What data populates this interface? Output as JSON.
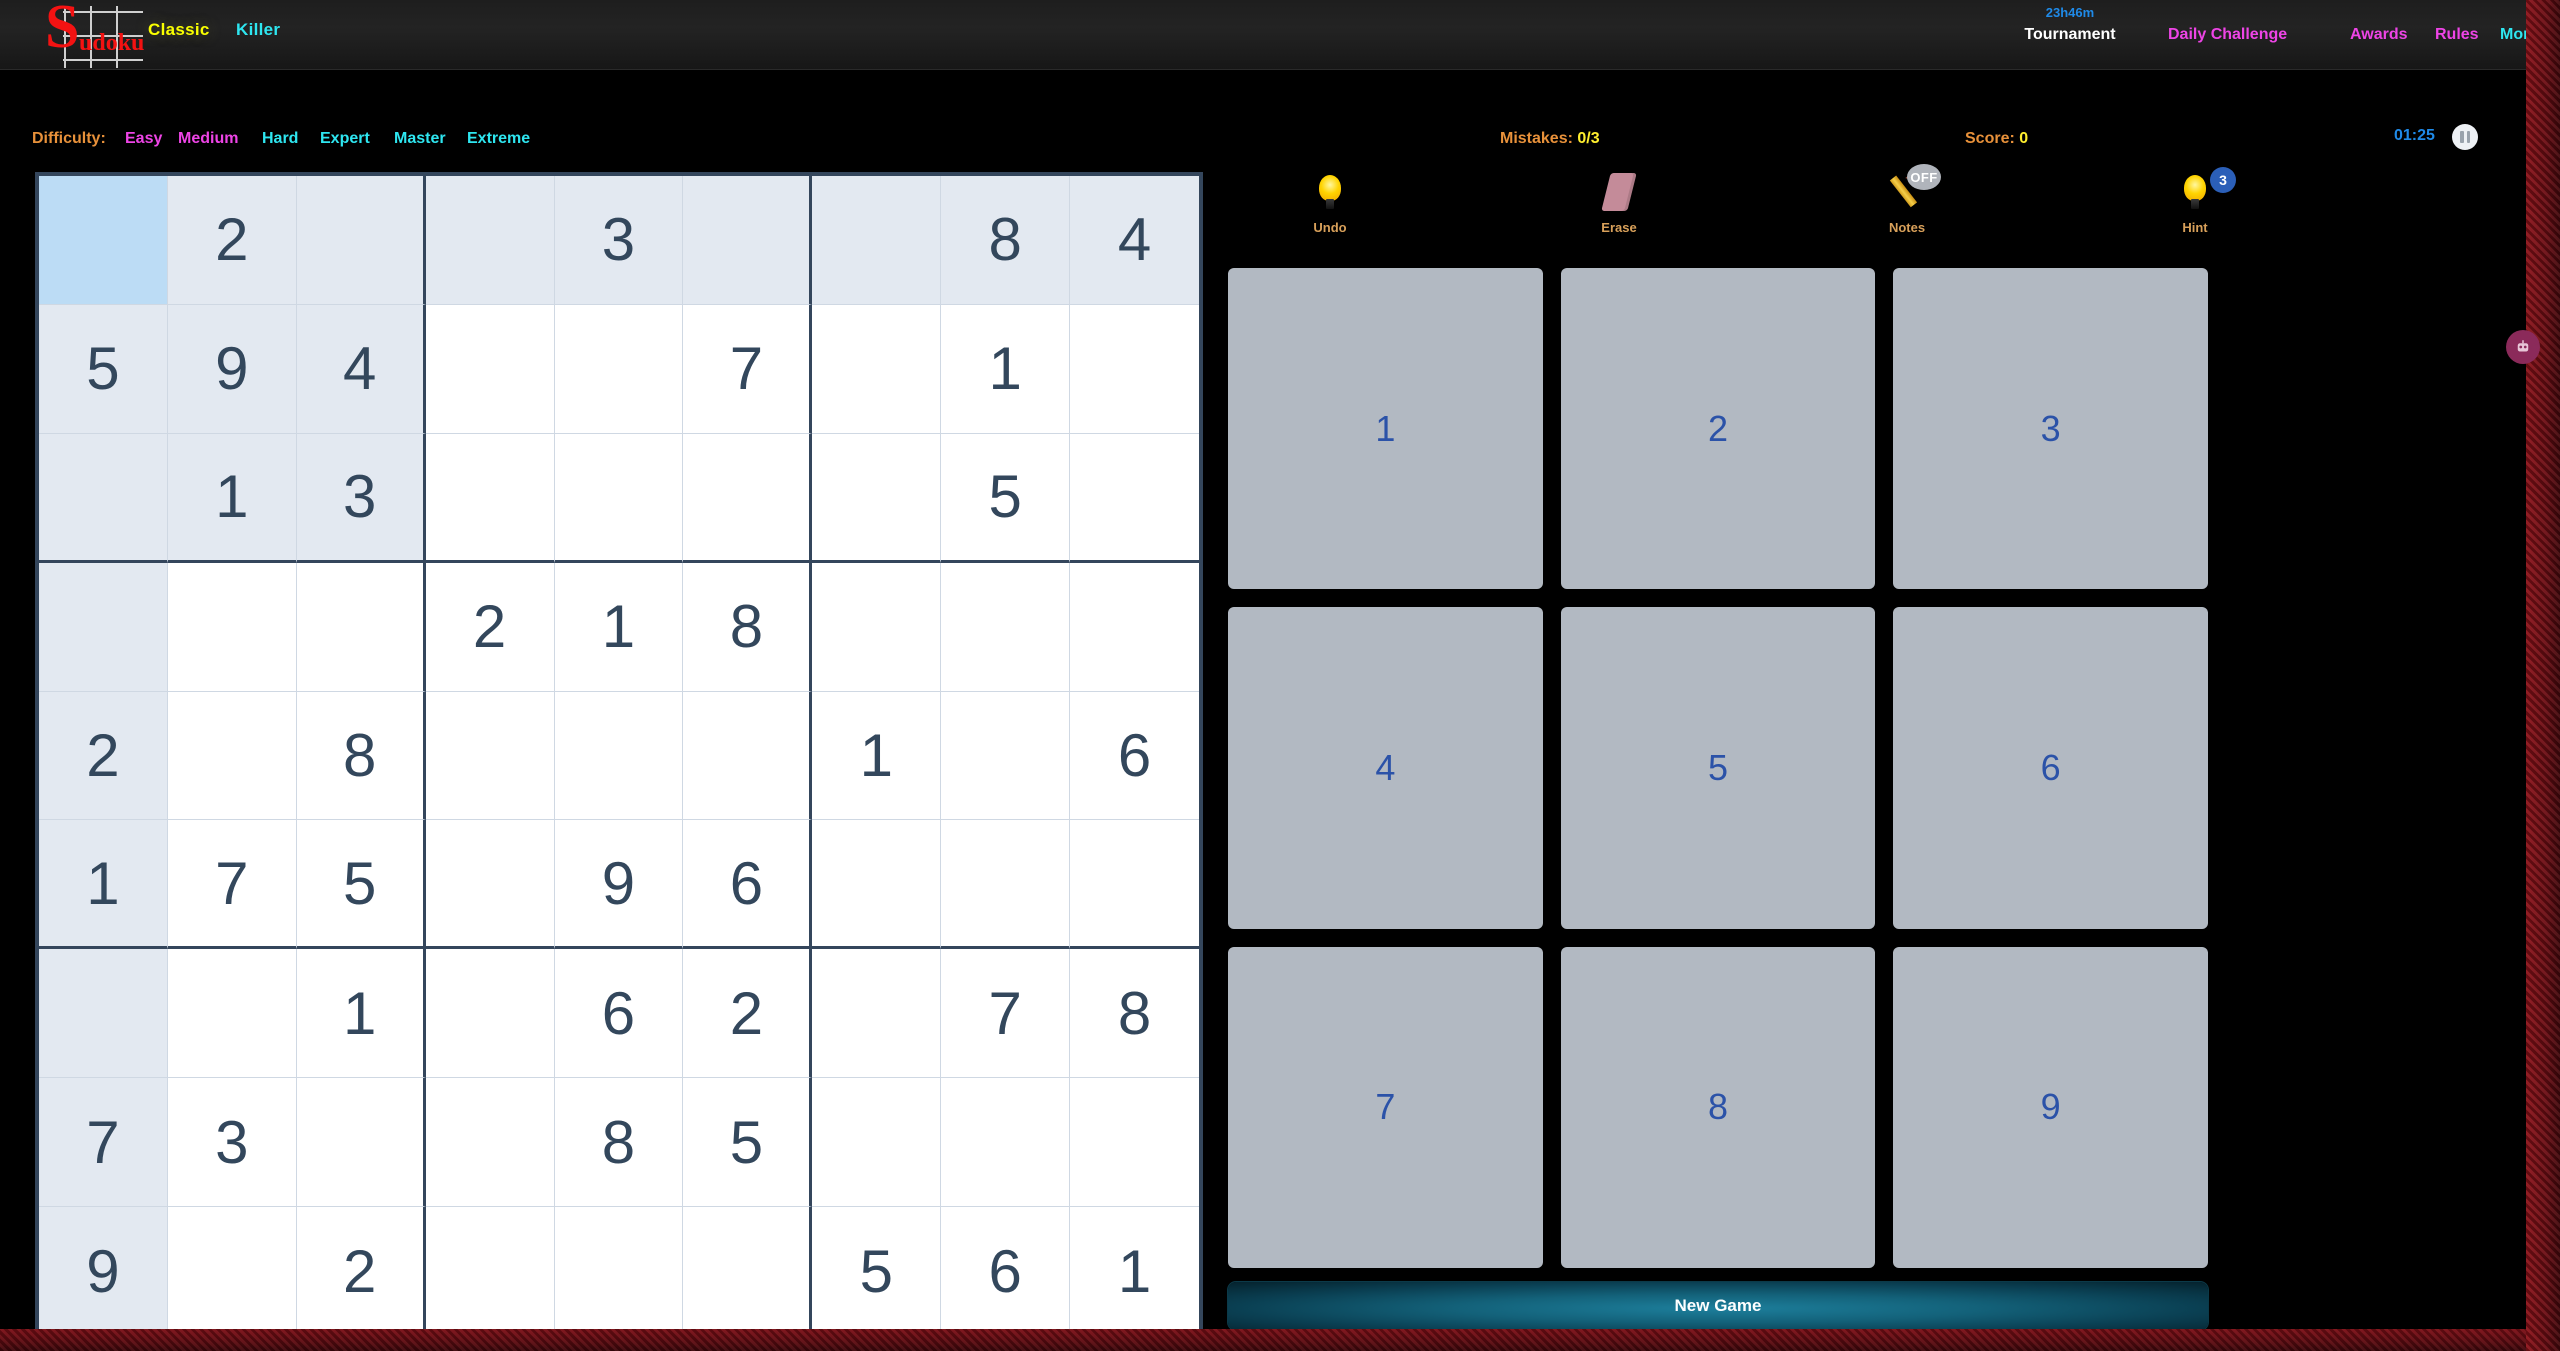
{
  "header": {
    "logo_letter": "S",
    "logo_word": "udoku",
    "logo_grid_icon": "grid-icon",
    "modes": [
      {
        "label": "Classic",
        "color": "#faff00",
        "active": true
      },
      {
        "label": "Killer",
        "color": "#2ee6f0",
        "active": false
      }
    ],
    "tournament_timer": "23h46m",
    "nav": [
      {
        "label": "Tournament",
        "color": "#ffffff"
      },
      {
        "label": "Daily Challenge",
        "color": "#ee44e6"
      },
      {
        "label": "Awards",
        "color": "#ee44e6"
      },
      {
        "label": "Rules",
        "color": "#ee44e6"
      },
      {
        "label": "More",
        "color": "#2ee6f0"
      }
    ]
  },
  "subbar": {
    "difficulty_label": "Difficulty:",
    "difficulties": [
      {
        "label": "Easy",
        "color": "#ee44e6"
      },
      {
        "label": "Medium",
        "color": "#ee44e6"
      },
      {
        "label": "Hard",
        "color": "#2ee6f0"
      },
      {
        "label": "Expert",
        "color": "#2ee6f0"
      },
      {
        "label": "Master",
        "color": "#2ee6f0"
      },
      {
        "label": "Extreme",
        "color": "#2ee6f0"
      }
    ],
    "mistakes_label": "Mistakes:",
    "mistakes_value": "0/3",
    "score_label": "Score:",
    "score_value": "0",
    "timer": "01:25",
    "pause_icon": "pause-icon",
    "label_color": "#e8913a",
    "value_color": "#ffef2e",
    "timer_color": "#1f8ae8"
  },
  "tools": [
    {
      "label": "Undo",
      "icon": "lightbulb-icon",
      "badge": null
    },
    {
      "label": "Erase",
      "icon": "eraser-icon",
      "badge": null
    },
    {
      "label": "Notes",
      "icon": "pencil-icon",
      "badge": "OFF"
    },
    {
      "label": "Hint",
      "icon": "lightbulb-icon",
      "badge": "3"
    }
  ],
  "numpad": {
    "keys": [
      "1",
      "2",
      "3",
      "4",
      "5",
      "6",
      "7",
      "8",
      "9"
    ],
    "key_color": "#2b52a8",
    "key_bg": "#b2b9c2"
  },
  "new_game_label": "New Game",
  "board": {
    "selected": {
      "row": 0,
      "col": 0
    },
    "colors": {
      "selected_bg": "#bcdcf5",
      "highlight_bg": "#e3e9f1",
      "cell_bg": "#ffffff",
      "digit": "#33475c",
      "border": "#34465c",
      "thin_line": "#cfd8e3"
    },
    "rows": [
      [
        "",
        "2",
        "",
        "",
        "3",
        "",
        "",
        "8",
        "4"
      ],
      [
        "5",
        "9",
        "4",
        "",
        "",
        "7",
        "",
        "1",
        ""
      ],
      [
        "",
        "1",
        "3",
        "",
        "",
        "",
        "",
        "5",
        ""
      ],
      [
        "",
        "",
        "",
        "2",
        "1",
        "8",
        "",
        "",
        ""
      ],
      [
        "2",
        "",
        "8",
        "",
        "",
        "",
        "1",
        "",
        "6"
      ],
      [
        "1",
        "7",
        "5",
        "",
        "9",
        "6",
        "",
        "",
        ""
      ],
      [
        "",
        "",
        "1",
        "",
        "6",
        "2",
        "",
        "7",
        "8"
      ],
      [
        "7",
        "3",
        "",
        "",
        "8",
        "5",
        "",
        "",
        ""
      ],
      [
        "9",
        "",
        "2",
        "",
        "",
        "",
        "5",
        "6",
        "1"
      ]
    ]
  },
  "decor": {
    "bot_tab_icon": "robot-icon"
  }
}
